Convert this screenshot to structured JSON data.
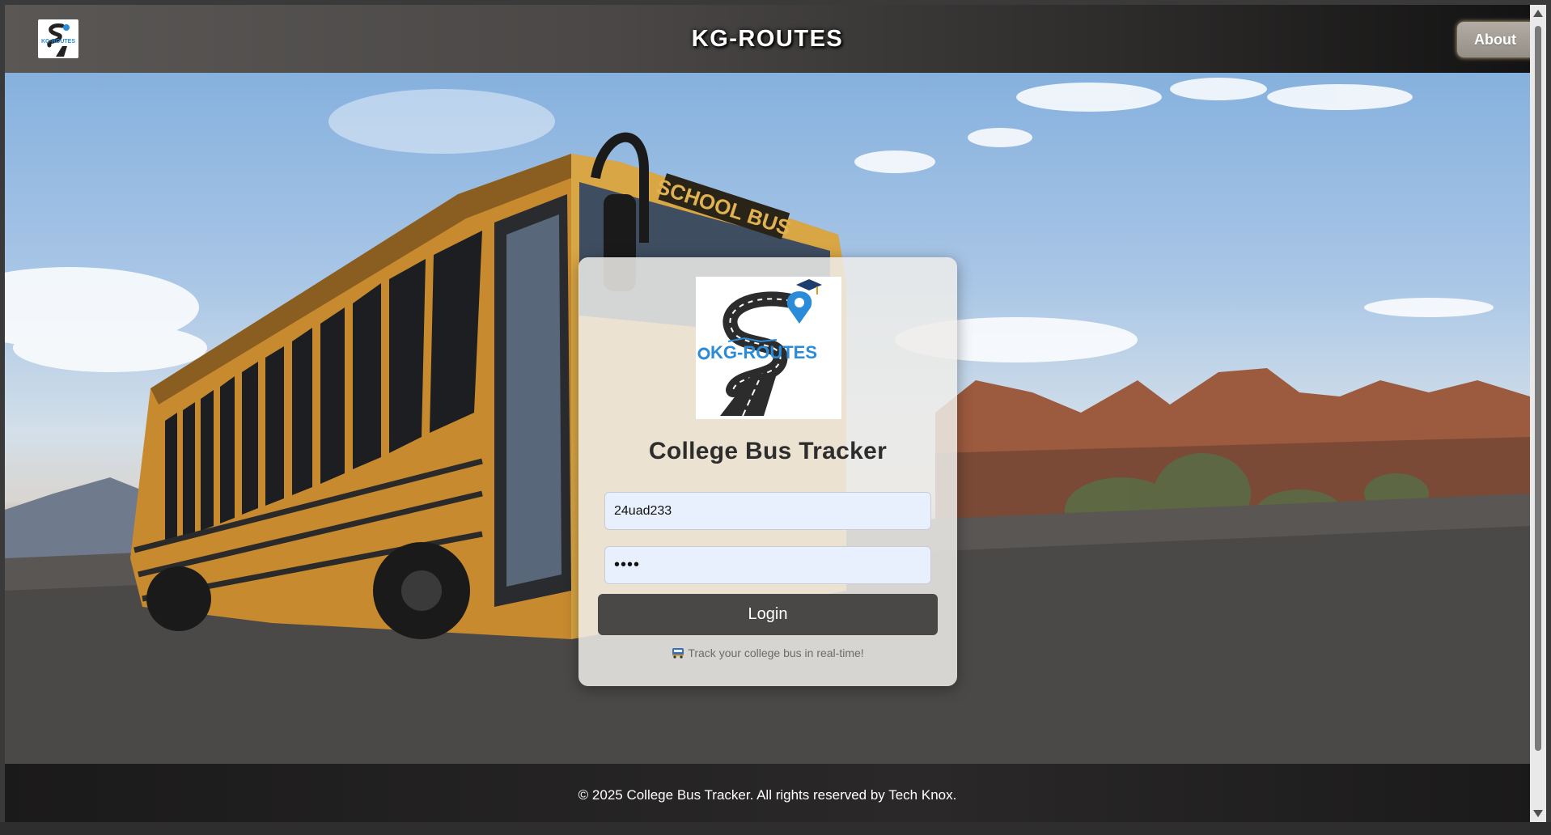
{
  "header": {
    "logo_icon": "kg-routes-logo-icon",
    "title": "KG-ROUTES",
    "about_label": "About"
  },
  "login": {
    "logo_icon": "kg-routes-logo-icon",
    "logo_text": "KG-ROUTES",
    "title": "College Bus Tracker",
    "username_value": "24uad233",
    "password_value": "••••",
    "login_label": "Login",
    "tagline": "Track your college bus in real-time!",
    "tagline_icon": "bus-icon"
  },
  "footer": {
    "text": "© 2025 College Bus Tracker. All rights reserved by Tech Knox."
  },
  "background": {
    "image_description_icon": "school-bus-desert-photo",
    "bus_sign_text": "SCHOOL BUS"
  },
  "colors": {
    "header_dark": "#141313",
    "button": "#4a4747",
    "input_fill": "#e8f0fe",
    "logo_blue": "#2a8bd8"
  }
}
